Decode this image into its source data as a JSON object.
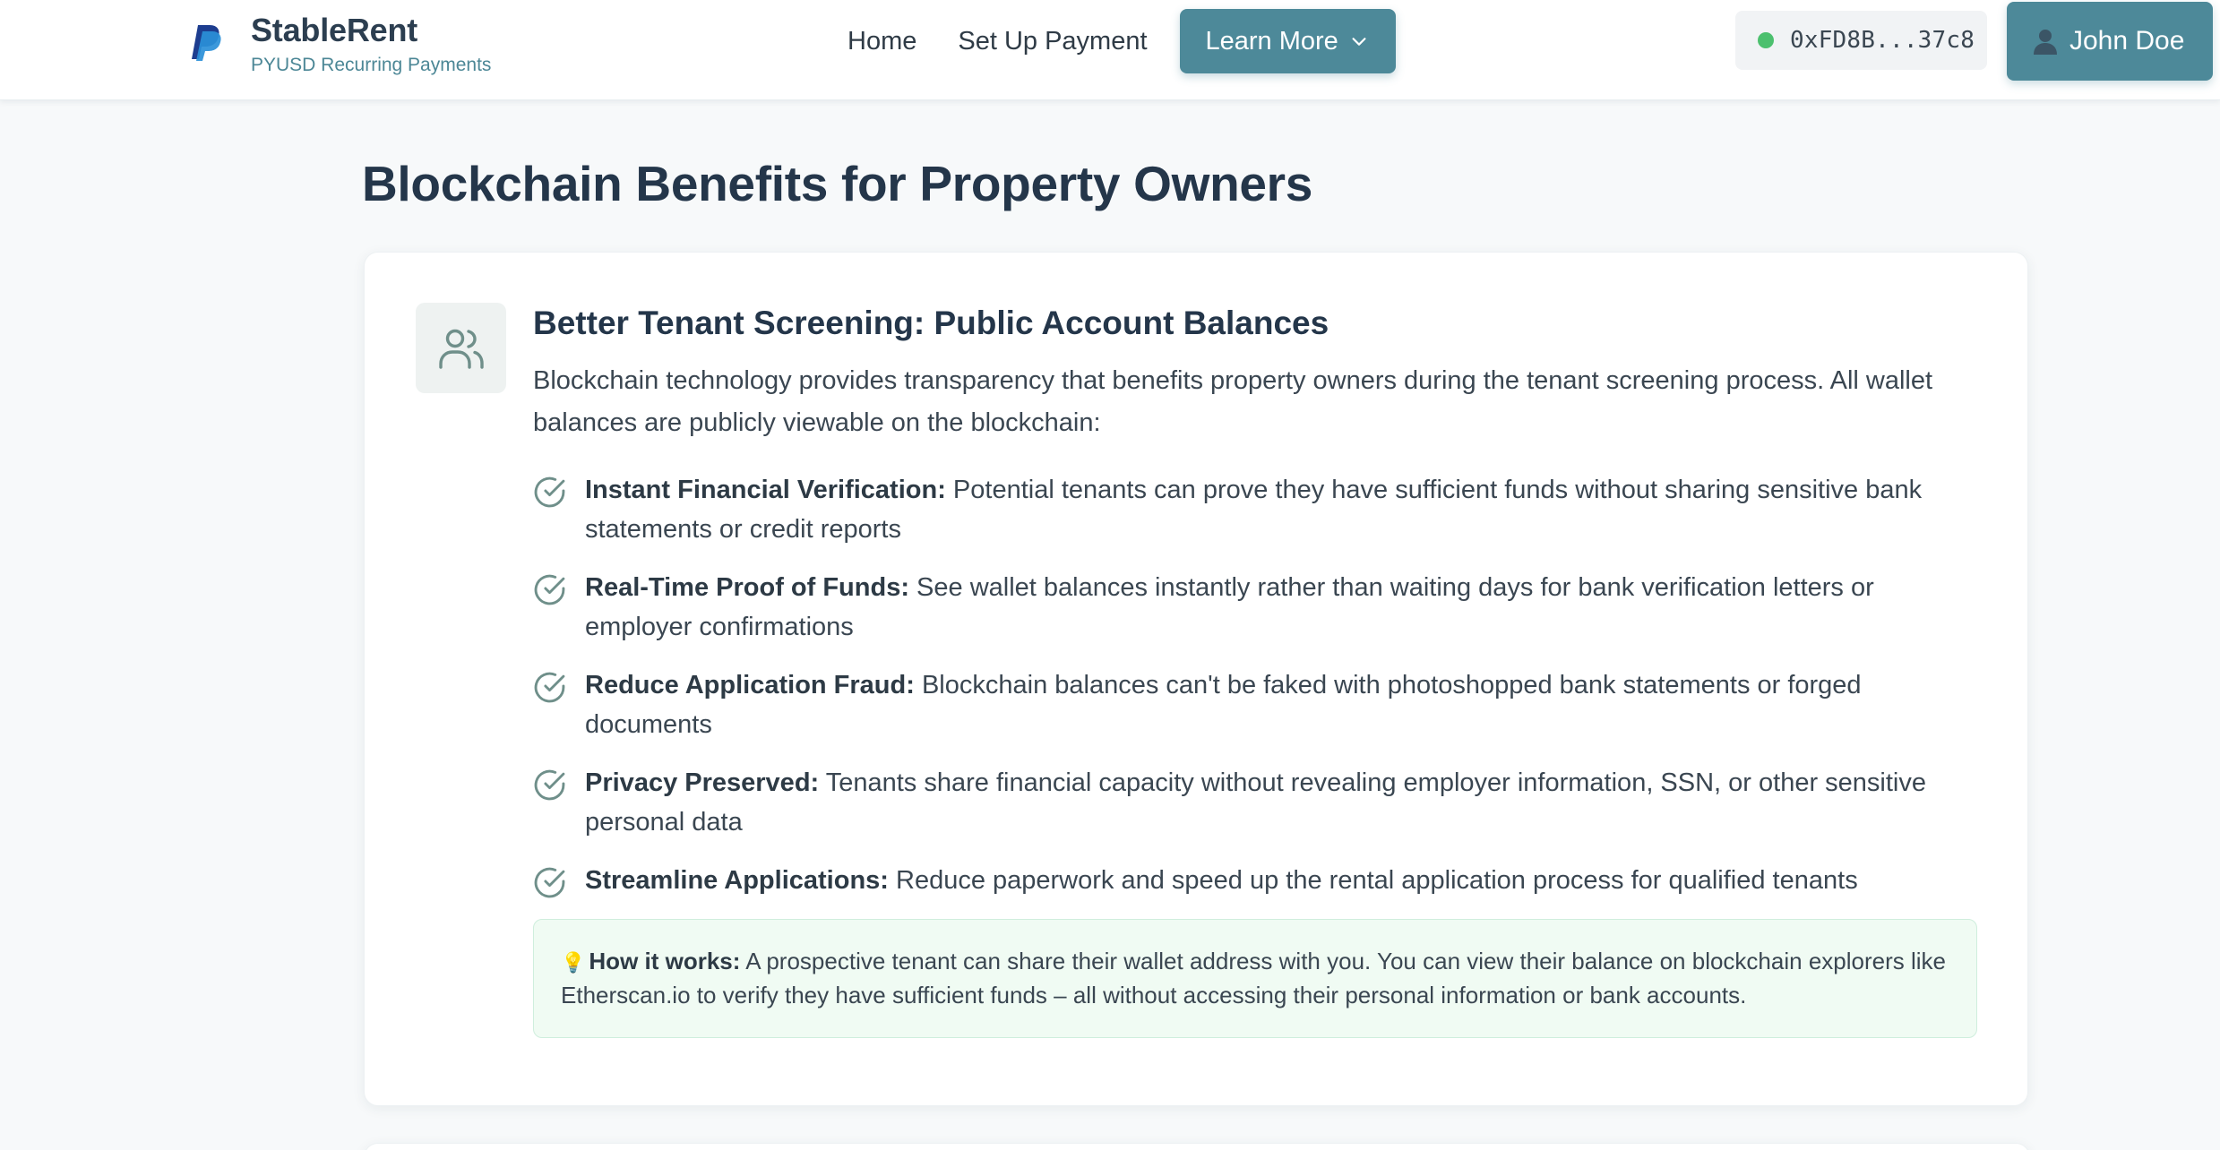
{
  "header": {
    "brand_name": "StableRent",
    "brand_tagline": "PYUSD Recurring Payments",
    "logo_icon": "paypal-logo-icon",
    "nav": {
      "home": "Home",
      "setup_payment": "Set Up Payment",
      "learn_more": "Learn More"
    },
    "wallet": {
      "status": "connected",
      "status_color": "#4cc06e",
      "address": "0xFD8B...37c8"
    },
    "user": {
      "name": "John Doe",
      "avatar_icon": "user-silhouette-icon"
    }
  },
  "main": {
    "page_title": "Blockchain Benefits for Property Owners",
    "card": {
      "icon": "users-icon",
      "title": "Better Tenant Screening: Public Account Balances",
      "intro": "Blockchain technology provides transparency that benefits property owners during the tenant screening process. All wallet balances are publicly viewable on the blockchain:",
      "benefits": [
        {
          "title": "Instant Financial Verification:",
          "text": " Potential tenants can prove they have sufficient funds without sharing sensitive bank statements or credit reports"
        },
        {
          "title": "Real-Time Proof of Funds:",
          "text": " See wallet balances instantly rather than waiting days for bank verification letters or employer confirmations"
        },
        {
          "title": "Reduce Application Fraud:",
          "text": " Blockchain balances can't be faked with photoshopped bank statements or forged documents"
        },
        {
          "title": "Privacy Preserved:",
          "text": " Tenants share financial capacity without revealing employer information, SSN, or other sensitive personal data"
        },
        {
          "title": "Streamline Applications:",
          "text": " Reduce paperwork and speed up the rental application process for qualified tenants"
        }
      ],
      "info": {
        "emoji": "💡",
        "label": "How it works:",
        "text": " A prospective tenant can share their wallet address with you. You can view their balance on blockchain explorers like Etherscan.io to verify they have sufficient funds – all without accessing their personal information or bank accounts."
      }
    }
  },
  "colors": {
    "accent": "#4d8999",
    "title": "#24364a",
    "info_background": "#f0fbf3",
    "page_background": "#f7f9fa"
  }
}
